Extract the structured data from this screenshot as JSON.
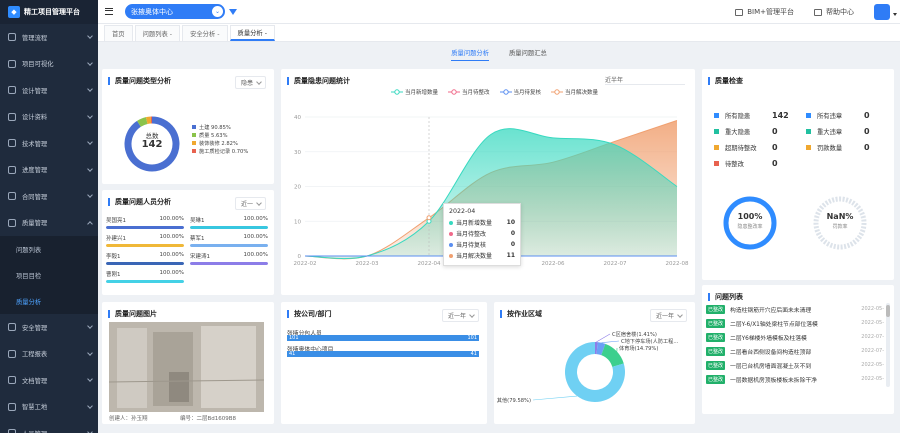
{
  "app": {
    "title": "精工项目管理平台"
  },
  "sidebar": {
    "items": [
      {
        "label": "管理流程"
      },
      {
        "label": "项目可视化"
      },
      {
        "label": "设计管理"
      },
      {
        "label": "设计资料"
      },
      {
        "label": "技术管理"
      },
      {
        "label": "进度管理"
      },
      {
        "label": "合同管理"
      },
      {
        "label": "质量管理"
      }
    ],
    "sub_items": [
      {
        "label": "问题列表"
      },
      {
        "label": "项目目检"
      },
      {
        "label": "质量分析"
      }
    ],
    "items_after": [
      {
        "label": "安全管理"
      },
      {
        "label": "工程报表"
      },
      {
        "label": "文档管理"
      },
      {
        "label": "智慧工地"
      },
      {
        "label": "人员管理"
      }
    ]
  },
  "topbar": {
    "project": "张掖奥体中心",
    "dropdown_glyph": "⌄",
    "bim_link": "BIM+管理平台",
    "help_link": "帮助中心"
  },
  "tabs": [
    {
      "label": "首页"
    },
    {
      "label": "问题列表 -"
    },
    {
      "label": "安全分析 -"
    },
    {
      "label": "质量分析 -"
    }
  ],
  "subtabs": [
    {
      "label": "质量问题分析"
    },
    {
      "label": "质量问题汇总"
    }
  ],
  "type_analysis": {
    "title": "质量问题类型分析",
    "select": "隐患",
    "total_label": "总数",
    "total": "142",
    "legend": [
      {
        "label": "土建 90.85%",
        "color": "#4a6fd1",
        "value": 90.85
      },
      {
        "label": "质量 5.63%",
        "color": "#8bc34a",
        "value": 5.63
      },
      {
        "label": "装饰装修 2.82%",
        "color": "#f0a830",
        "value": 2.82
      },
      {
        "label": "施工质检记录 0.70%",
        "color": "#e8624f",
        "value": 0.7
      }
    ]
  },
  "personnel": {
    "title": "质量问题人员分析",
    "select": "近一",
    "rows": [
      {
        "name": "吴国亮1",
        "pct": "100.00%",
        "value": 100,
        "color": "#4a6fd1"
      },
      {
        "name": "吴琳1",
        "pct": "100.00%",
        "value": 100,
        "color": "#38c7e0"
      },
      {
        "name": "孙建兴1",
        "pct": "100.00%",
        "value": 100,
        "color": "#f0b838"
      },
      {
        "name": "蔡军1",
        "pct": "100.00%",
        "value": 100,
        "color": "#79b0ef"
      },
      {
        "name": "李毅1",
        "pct": "100.00%",
        "value": 100,
        "color": "#3a66b6"
      },
      {
        "name": "宋建涛1",
        "pct": "100.00%",
        "value": 100,
        "color": "#8c7de8"
      },
      {
        "name": "曹刚1",
        "pct": "100.00%",
        "value": 100,
        "color": "#44d1e6"
      }
    ]
  },
  "hidden_stats": {
    "title": "质量隐患问题统计",
    "select": "近半年",
    "legend": [
      {
        "label": "当月新增数量",
        "color": "#38d9c0"
      },
      {
        "label": "当月待整改",
        "color": "#f06a8a"
      },
      {
        "label": "当月待复核",
        "color": "#5a8ef0"
      },
      {
        "label": "当月解决数量",
        "color": "#f0a070"
      }
    ]
  },
  "chart_data": {
    "type": "area",
    "title": "质量隐患问题统计",
    "categories": [
      "2022-02",
      "2022-03",
      "2022-04",
      "2022-05",
      "2022-06",
      "2022-07",
      "2022-08"
    ],
    "x_ticks": [
      "2022-02",
      "2022-03",
      "2022-04",
      "2022-05",
      "2022-06",
      "2022-07",
      "2022-08"
    ],
    "y_ticks": [
      "0",
      "10",
      "20",
      "30",
      "40"
    ],
    "ylim": [
      0,
      40
    ],
    "series": [
      {
        "name": "当月新增数量",
        "values": [
          0,
          0,
          10,
          35,
          34,
          32,
          20
        ]
      },
      {
        "name": "当月待整改",
        "values": [
          0,
          0,
          0,
          0,
          0,
          0,
          0
        ]
      },
      {
        "name": "当月待复核",
        "values": [
          0,
          0,
          0,
          0,
          0,
          0,
          0
        ]
      },
      {
        "name": "当月解决数量",
        "values": [
          0,
          0,
          11,
          24,
          27,
          33,
          39
        ]
      }
    ],
    "tooltip": {
      "date": "2022-04",
      "rows": [
        {
          "name": "当月新增数量",
          "value": "10"
        },
        {
          "name": "当月待整改",
          "value": "0"
        },
        {
          "name": "当月待复核",
          "value": "0"
        },
        {
          "name": "当月解决数量",
          "value": "11"
        }
      ]
    }
  },
  "quality_check": {
    "title": "质量检查",
    "left": [
      {
        "label": "所有隐患",
        "value": "142",
        "color": "#2f8cff"
      },
      {
        "label": "重大隐患",
        "value": "0",
        "color": "#21c0a0"
      },
      {
        "label": "超期待整改",
        "value": "0",
        "color": "#f0a830"
      },
      {
        "label": "待整改",
        "value": "0",
        "color": "#e8624f"
      }
    ],
    "right": [
      {
        "label": "所有违章",
        "value": "0",
        "color": "#2f8cff"
      },
      {
        "label": "重大违章",
        "value": "0",
        "color": "#21c0a0"
      },
      {
        "label": "罚款数量",
        "value": "0",
        "color": "#f0a830"
      }
    ],
    "gauge1": {
      "value": "100%",
      "label": "隐患整改率",
      "fraction": 1.0
    },
    "gauge2": {
      "value": "NaN%",
      "label": "罚款率"
    }
  },
  "issue_list": {
    "title": "问题列表",
    "tag": "已整改",
    "rows": [
      {
        "text": "构造柱钢筋开穴应后面未未清理",
        "date": "2022-05-"
      },
      {
        "text": "二层Y-6/X1轴处梁柱节点部位落模",
        "date": "2022-05-"
      },
      {
        "text": "二层Y6梯楼外墙模板及柱落模",
        "date": "2022-07-"
      },
      {
        "text": "二层看台西侧设备间构造柱顶部",
        "date": "2022-07-"
      },
      {
        "text": "一层已台机房墙面混凝土灰不到",
        "date": "2022-05-"
      },
      {
        "text": "一层数据机房顶板楼板未拆除干净",
        "date": "2022-05-"
      }
    ]
  },
  "photo_card": {
    "title": "质量问题图片",
    "creator": "创建人：孙玉翔",
    "code": "编号：二层Bd1609B8"
  },
  "dept": {
    "title": "按公司/部门",
    "select": "近一年",
    "rows": [
      {
        "label": "张掖分包人员",
        "left": "101",
        "right": "101"
      },
      {
        "label": "张掖奥体中心项目",
        "left": "41",
        "right": "41"
      }
    ]
  },
  "area": {
    "title": "按作业区域",
    "select": "近一年",
    "slices": [
      {
        "label": "C区宿舍楼(1.41%)",
        "value": 1.41,
        "color": "#8c7de8"
      },
      {
        "label": "C地下停车场(人防工程...",
        "value": 4.22,
        "color": "#6aa0f5"
      },
      {
        "label": "体育场(14.79%)",
        "value": 14.79,
        "color": "#3ccf8e"
      },
      {
        "label": "其他(79.58%)",
        "value": 79.58,
        "color": "#6fd0f3"
      }
    ]
  }
}
